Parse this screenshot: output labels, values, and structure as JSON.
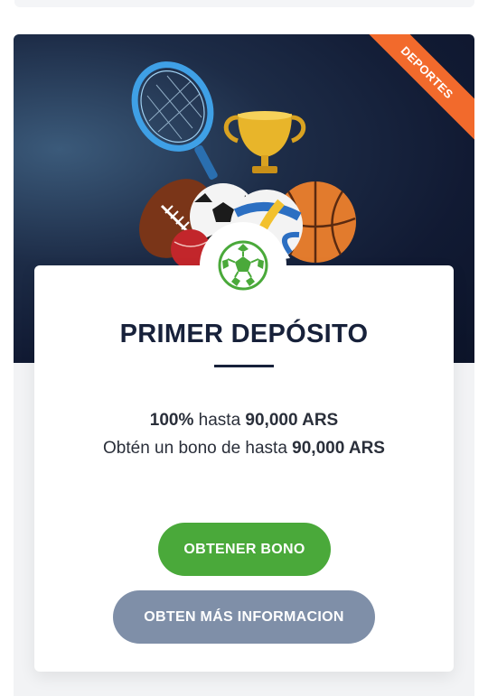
{
  "badge": {
    "label": "DEPORTES"
  },
  "promo": {
    "title": "PRIMER DEPÓSITO",
    "line1": {
      "percent": "100%",
      "middle": " hasta ",
      "amount": "90,000 ARS"
    },
    "line2": {
      "prefix": "Obtén un bono de hasta ",
      "amount": "90,000 ARS"
    }
  },
  "buttons": {
    "primary": "OBTENER BONO",
    "secondary": "OBTEN MÁS INFORMACION"
  },
  "icons": {
    "banner_art": "sports-equipment-illustration",
    "badge_icon": "soccer-ball-icon"
  },
  "colors": {
    "banner_bg": "#111a33",
    "ribbon": "#f26a2c",
    "primary_button": "#4aa93a",
    "secondary_button": "#7f8fa8",
    "title": "#17213a",
    "soccer_icon": "#4aa93a"
  }
}
